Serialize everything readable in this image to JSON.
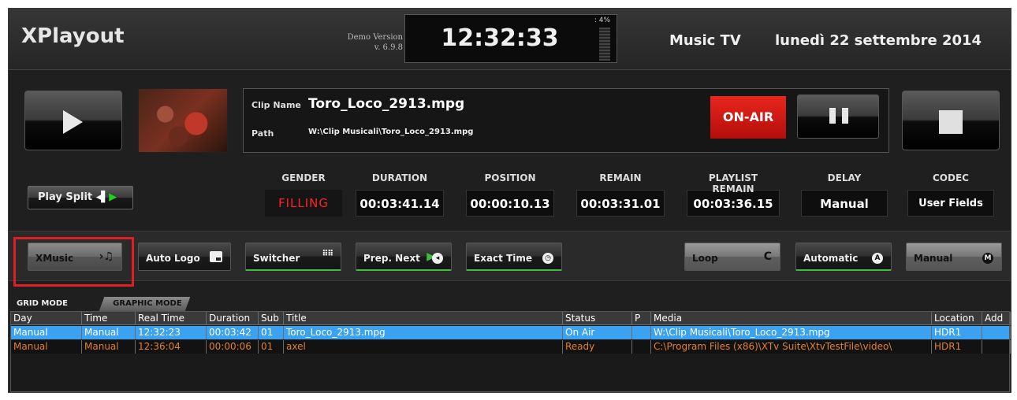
{
  "header": {
    "app_title": "XPlayout",
    "demo_line1": "Demo Version",
    "demo_line2": "v. 6.9.8",
    "clock": "12:32:33",
    "cpu": ": 4%",
    "channel": "Music TV",
    "date": "lunedì 22 settembre 2014"
  },
  "clip": {
    "name_label": "Clip Name",
    "name": "Toro_Loco_2913.mpg",
    "path_label": "Path",
    "path": "W:\\Clip Musicali\\Toro_Loco_2913.mpg",
    "onair_label": "ON-AIR"
  },
  "play_split": {
    "label": "Play Split",
    "arrow": "◂▌",
    "play": "▶"
  },
  "info": {
    "gender": {
      "label": "GENDER",
      "value": "FILLING"
    },
    "duration": {
      "label": "DURATION",
      "value": "00:03:41.14"
    },
    "position": {
      "label": "POSITION",
      "value": "00:00:10.13"
    },
    "remain": {
      "label": "REMAIN",
      "value": "00:03:31.01"
    },
    "playlist_remain": {
      "label": "PLAYLIST REMAIN",
      "value": "00:03:36.15"
    },
    "delay": {
      "label": "DELAY",
      "value": "Manual"
    },
    "codec": {
      "label": "CODEC",
      "value": "User Fields"
    }
  },
  "toolbar": {
    "xmusic": "XMusic",
    "xmusic_icon": "›♫",
    "auto_logo": "Auto Logo",
    "switcher": "Switcher",
    "prep_next": "Prep. Next",
    "exact_time": "Exact Time",
    "loop": "Loop",
    "loop_icon": "C",
    "automatic": "Automatic",
    "automatic_icon": "A",
    "manual": "Manual",
    "manual_icon": "M"
  },
  "tabs": {
    "grid": "GRID MODE",
    "graphic": "GRAPHIC MODE"
  },
  "grid": {
    "columns": [
      "Day",
      "Time",
      "Real Time",
      "Duration",
      "Sub",
      "Title",
      "Status",
      "P",
      "Media",
      "Location",
      "Add"
    ],
    "rows": [
      [
        "Manual",
        "Manual",
        "12:32:23",
        "00:03:42",
        "01",
        "Toro_Loco_2913.mpg",
        "On Air",
        "",
        "W:\\Clip Musicali\\Toro_Loco_2913.mpg",
        "HDR1",
        ""
      ],
      [
        "Manual",
        "Manual",
        "12:36:04",
        "00:00:06",
        "01",
        "axel",
        "Ready",
        "",
        "C:\\Program Files (x86)\\XTv Suite\\XtvTestFile\\video\\",
        "HDR1",
        ""
      ]
    ]
  },
  "colors": {
    "onair": "#e8261e",
    "selected_row": "#3aa2f0",
    "ready_row_text": "#e08030",
    "active_underline": "#3dbf3d",
    "highlight_frame": "#e02020"
  }
}
